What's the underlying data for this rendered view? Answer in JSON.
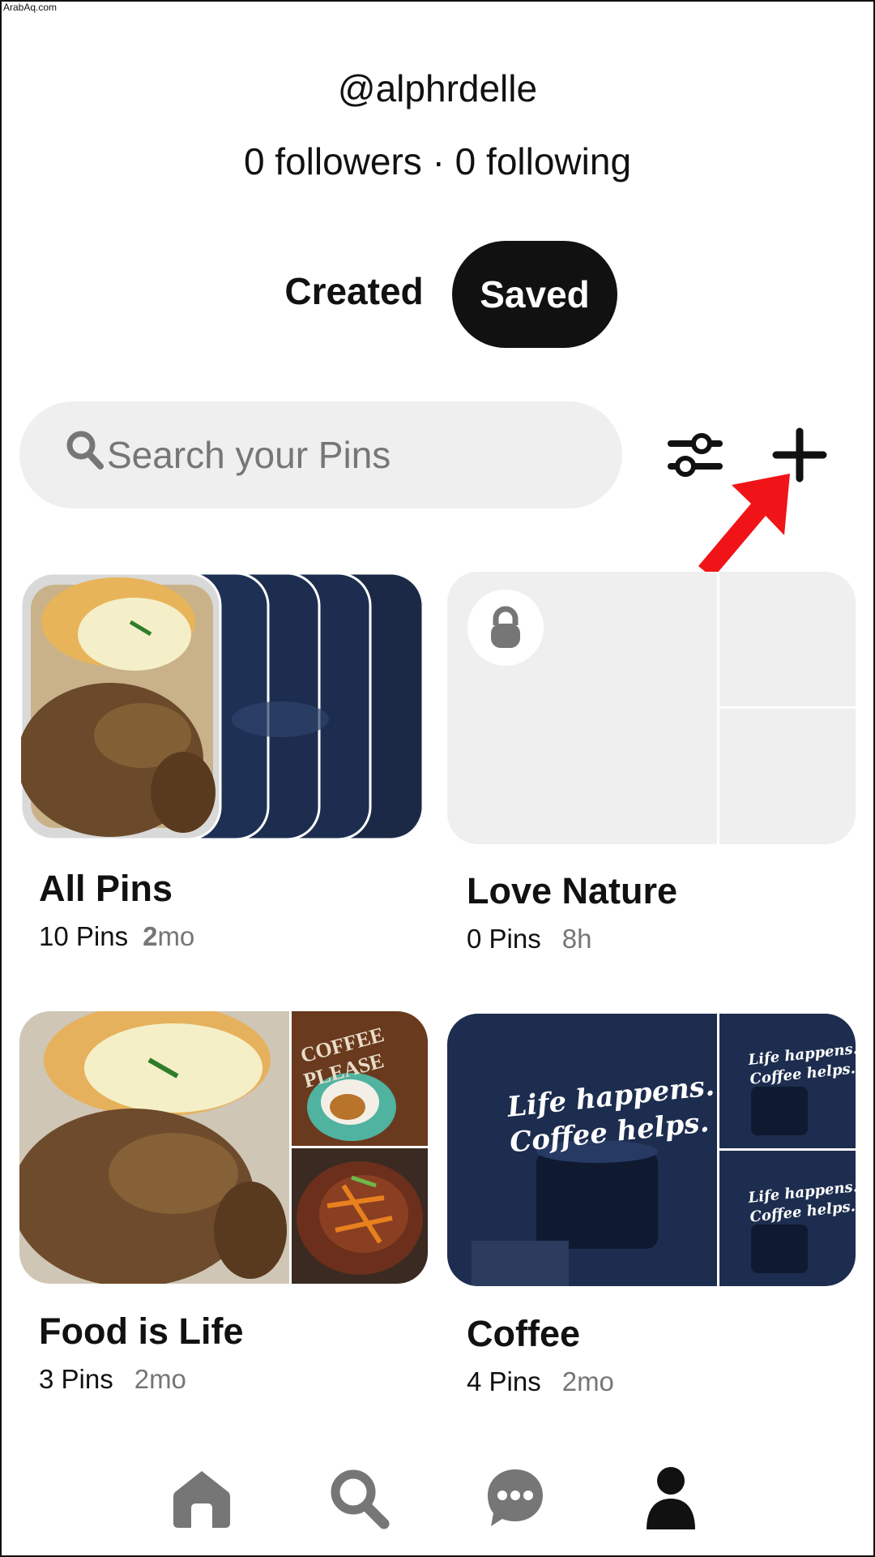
{
  "watermark": "ArabAq.com",
  "profile": {
    "username": "@alphrdelle",
    "stats": "0 followers · 0 following"
  },
  "tabs": {
    "created": "Created",
    "saved": "Saved",
    "active": "Saved"
  },
  "search": {
    "placeholder": "Search your Pins",
    "value": ""
  },
  "toolbar": {
    "filter_icon": "sliders-icon",
    "add_icon": "plus-icon"
  },
  "annotation": {
    "arrow_color": "#f01418"
  },
  "boards": [
    {
      "title": "All Pins",
      "pins": "10 Pins",
      "age_strong": "2",
      "age": "mo"
    },
    {
      "title": "Love Nature",
      "pins": "0 Pins",
      "age": "8h",
      "secret": true
    },
    {
      "title": "Food is Life",
      "pins": "3 Pins",
      "age": "2mo"
    },
    {
      "title": "Coffee",
      "pins": "4 Pins",
      "age": "2mo"
    }
  ],
  "cover_text": {
    "coffee_quote_line1": "Life happens.",
    "coffee_quote_line2": "Coffee helps.",
    "coffee_please_line1": "COFFEE",
    "coffee_please_line2": "PLEASE"
  },
  "bottom_nav": {
    "items": [
      "home-icon",
      "search-icon",
      "messages-icon",
      "profile-icon"
    ],
    "active": "profile-icon"
  },
  "colors": {
    "accent_dark": "#111111",
    "search_bg": "#efefef",
    "placeholder_gray": "#767676",
    "nav_inactive": "#767676",
    "coffee_navy": "#1d2d4f"
  }
}
